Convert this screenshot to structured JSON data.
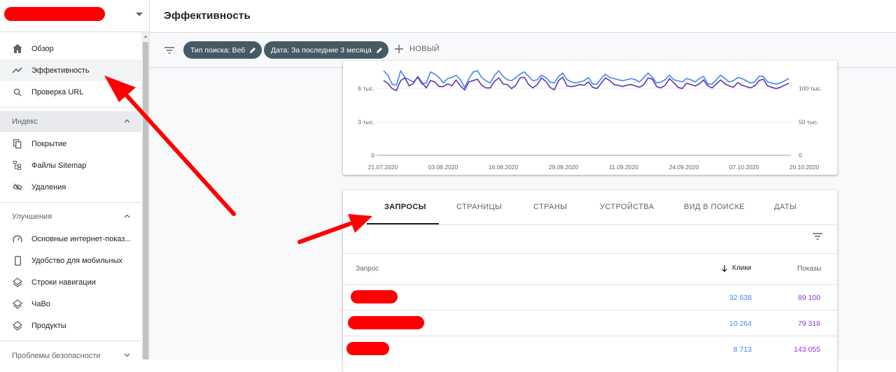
{
  "sidebar": {
    "items_main": [
      {
        "label": "Обзор",
        "icon": "home-icon"
      },
      {
        "label": "Эффективность",
        "icon": "trending-up-icon"
      },
      {
        "label": "Проверка URL",
        "icon": "search-icon"
      }
    ],
    "section_index": "Индекс",
    "items_index": [
      {
        "label": "Покрытие",
        "icon": "file-copy-icon"
      },
      {
        "label": "Файлы Sitemap",
        "icon": "sitemap-icon"
      },
      {
        "label": "Удаления",
        "icon": "visibility-off-icon"
      }
    ],
    "section_improvements": "Улучшения",
    "items_improvements": [
      {
        "label": "Основные интернет-показ...",
        "icon": "speed-icon"
      },
      {
        "label": "Удобство для мобильных",
        "icon": "smartphone-icon"
      },
      {
        "label": "Строки навигации",
        "icon": "layers-icon"
      },
      {
        "label": "ЧаВо",
        "icon": "layers-icon"
      },
      {
        "label": "Продукты",
        "icon": "layers-icon"
      }
    ],
    "section_security": "Проблемы безопасности"
  },
  "header": {
    "title": "Эффективность"
  },
  "filters": {
    "chip1": "Тип поиска: Веб",
    "chip2": "Дата: За последние 3 месяца",
    "new_label": "НОВЫЙ"
  },
  "chart_data": {
    "type": "line",
    "x_ticks": [
      "21.07.2020",
      "03.08.2020",
      "16.08.2020",
      "29.08.2020",
      "11.09.2020",
      "24.09.2020",
      "07.10.2020",
      "20.10.2020"
    ],
    "y_left_ticks": [
      "0",
      "3 тыс.",
      "6 тыс."
    ],
    "y_right_ticks": [
      "0",
      "50 тыс.",
      "100 тыс."
    ],
    "ylim_left": [
      0,
      9000
    ],
    "ylim_right": [
      0,
      150000
    ],
    "series": [
      {
        "color": "#4285f4",
        "axis": "left",
        "values": [
          7600,
          7200,
          6400,
          6300,
          7600,
          7000,
          6800,
          6600,
          7000,
          6400,
          6500,
          7500,
          7300,
          7000,
          6500,
          6900,
          7000,
          7200,
          6800,
          6100,
          6900,
          7500,
          7600,
          7000,
          6700,
          6500,
          7200,
          7600,
          7100,
          6800,
          6700,
          7000,
          7300,
          7500,
          7100,
          6700,
          6800,
          7200,
          7000,
          6600,
          6500,
          7100,
          7400,
          6800,
          6600,
          6500,
          6600,
          6700,
          7000,
          6400,
          6400,
          6900,
          7300,
          7000,
          6900,
          6800,
          6700,
          6800,
          6900,
          6800,
          6600,
          7000,
          7400,
          7000,
          6500,
          6600,
          6800,
          7200,
          6800,
          6700,
          6600,
          6900,
          6800,
          6600,
          6900,
          7100,
          6400,
          6400,
          6800,
          7200,
          6900,
          6600,
          6700,
          7000,
          6900,
          6700,
          6500,
          6600,
          7100,
          7100,
          6600,
          6500,
          6400,
          6500,
          6700,
          6900
        ]
      },
      {
        "color": "#5e35b1",
        "axis": "right",
        "values": [
          112000,
          108000,
          100000,
          97000,
          112000,
          116000,
          104000,
          108000,
          118000,
          109000,
          101000,
          112000,
          110000,
          103000,
          103000,
          107000,
          104000,
          113000,
          104000,
          98000,
          110000,
          112000,
          114000,
          105000,
          101000,
          101000,
          111000,
          116000,
          107000,
          106000,
          100000,
          105000,
          116000,
          117000,
          106000,
          101000,
          106000,
          116000,
          111000,
          102000,
          98000,
          112000,
          117000,
          104000,
          103000,
          104000,
          106000,
          105000,
          110000,
          102000,
          100000,
          108000,
          116000,
          112000,
          106000,
          105000,
          103000,
          105000,
          106000,
          104000,
          102000,
          106000,
          116000,
          114000,
          103000,
          101000,
          105000,
          115000,
          109000,
          102000,
          100000,
          108000,
          106000,
          104000,
          107000,
          113000,
          104000,
          101000,
          107000,
          113000,
          107000,
          104000,
          102000,
          109000,
          105000,
          103000,
          101000,
          104000,
          112000,
          114000,
          104000,
          102000,
          100000,
          102000,
          105000,
          108000
        ]
      }
    ]
  },
  "tabs": [
    "ЗАПРОСЫ",
    "СТРАНИЦЫ",
    "СТРАНЫ",
    "УСТРОЙСТВА",
    "ВИД В ПОИСКЕ",
    "ДАТЫ"
  ],
  "table": {
    "col_query": "Запрос",
    "col_clicks": "Клики",
    "col_impressions": "Показы",
    "rows": [
      {
        "clicks": "32 638",
        "impressions": "89 100"
      },
      {
        "clicks": "10 264",
        "impressions": "79 318"
      },
      {
        "clicks": "8 713",
        "impressions": "143 055"
      }
    ]
  },
  "colors": {
    "clicks": "#4285f4",
    "impressions": "#9334e6",
    "annotation": "#ff0000",
    "chip": "#455a64"
  }
}
